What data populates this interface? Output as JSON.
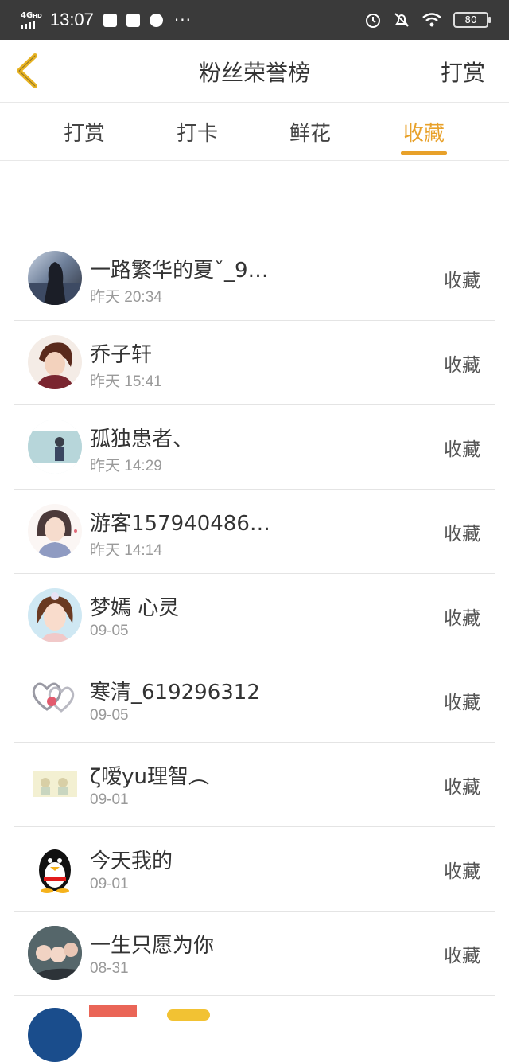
{
  "status_bar": {
    "network": "4G",
    "network_sup": "HD",
    "time": "13:07",
    "more": "···",
    "battery": "80"
  },
  "nav": {
    "title": "粉丝荣誉榜",
    "right_label": "打赏"
  },
  "tabs": [
    {
      "label": "打赏",
      "active": false
    },
    {
      "label": "打卡",
      "active": false
    },
    {
      "label": "鲜花",
      "active": false
    },
    {
      "label": "收藏",
      "active": true
    }
  ],
  "colors": {
    "accent": "#e8a12a",
    "status_bar": "#3a3a3a",
    "text": "#333333",
    "subtext": "#9a9a9a"
  },
  "fans": [
    {
      "name": "一路繁华的夏ˇ_9…",
      "date": "昨天 20:34",
      "action": "收藏",
      "avatar_icon": "avatar-photo"
    },
    {
      "name": "乔子轩",
      "date": "昨天 15:41",
      "action": "收藏",
      "avatar_icon": "avatar-photo"
    },
    {
      "name": "孤独患者、",
      "date": "昨天 14:29",
      "action": "收藏",
      "avatar_icon": "avatar-photo"
    },
    {
      "name": "游客157940486…",
      "date": "昨天 14:14",
      "action": "收藏",
      "avatar_icon": "avatar-photo"
    },
    {
      "name": "梦嫣 心灵",
      "date": "09-05",
      "action": "收藏",
      "avatar_icon": "avatar-photo"
    },
    {
      "name": "寒清_619296312",
      "date": "09-05",
      "action": "收藏",
      "avatar_icon": "avatar-photo"
    },
    {
      "name": "ζ嗳yu理智︵",
      "date": "09-01",
      "action": "收藏",
      "avatar_icon": "avatar-photo"
    },
    {
      "name": "今天我的",
      "date": "09-01",
      "action": "收藏",
      "avatar_icon": "penguin-icon"
    },
    {
      "name": "一生只愿为你",
      "date": "08-31",
      "action": "收藏",
      "avatar_icon": "avatar-photo"
    }
  ]
}
